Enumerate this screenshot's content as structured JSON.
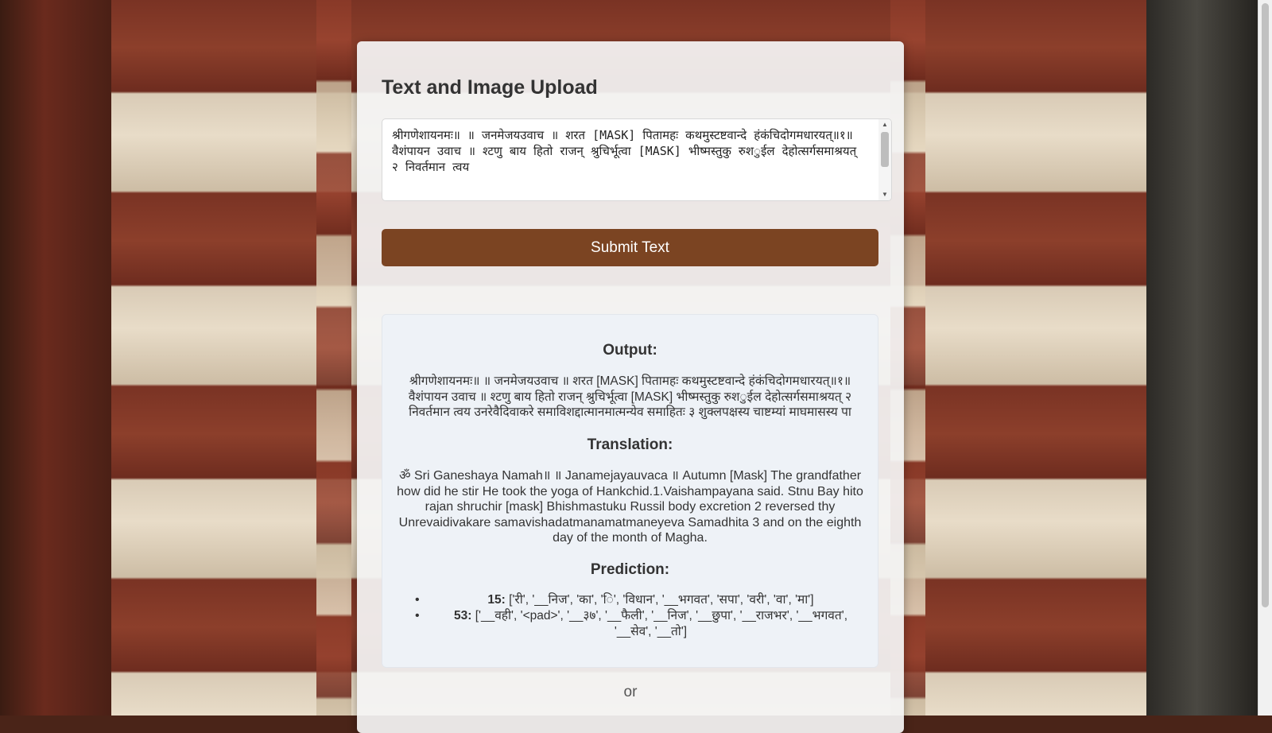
{
  "page": {
    "title": "Text and Image Upload",
    "input": {
      "value": "श्रीगणेशायनमः॥ ॥ जनमेजयउवाच ॥ शरत [MASK] पितामहः कथमुस्टष्टवान्दे हंकंचिदोगमधारयत्॥१॥वैशंपायन उवाच ॥ श्टणु बाय हितो राजन् श्रुचिर्भूत्वा [MASK] भीष्मस्तुकु रुश◌ुईल देहोत्सर्गसमाश्रयत् २ निवर्तमान त्वय"
    },
    "submit_label": "Submit Text",
    "or_label": "or"
  },
  "result": {
    "output_heading": "Output:",
    "output_text": "श्रीगणेशायनमः॥ ॥ जनमेजयउवाच ॥ शरत [MASK] पितामहः कथमुस्टष्टवान्दे हंकंचिदोगमधारयत्॥१॥ वैशंपायन उवाच ॥ श्टणु बाय हितो राजन् श्रुचिर्भूत्वा [MASK] भीष्मस्तुकु रुश◌ुईल देहोत्सर्गसमाश्रयत् २ निवर्तमान त्वय उनरेवैदिवाकरे समाविशद्दात्मानमात्मन्येव समाहितः ३ शुक्लपक्षस्य चाष्टम्यां माघमासस्य पा",
    "translation_heading": "Translation:",
    "translation_text": "ॐ Sri Ganeshaya Namah॥ ॥ Janamejayauvaca ॥ Autumn [Mask] The grandfather how did he stir He took the yoga of Hankchid.1.Vaishampayana said. Stnu Bay hito rajan shruchir [mask] Bhishmastuku Russil body excretion 2 reversed thy Unrevaidivakare samavishadatmanamatmaneyeva Samadhita 3 and on the eighth day of the month of Magha.",
    "prediction_heading": "Prediction:",
    "predictions": [
      {
        "key": "15:",
        "value": "['री', '__निज', 'का', '◌ि', 'विधान', '__भगवत', 'सपा', 'वरी', 'वा', 'मा']"
      },
      {
        "key": "53:",
        "value": "['__वही', '<pad>', '__३७', '__फैली', '__निज', '__छुपा', '__राजभर', '__भगवत', '__सेव', '__तो']"
      }
    ]
  },
  "colors": {
    "submit_button": "#7b4422",
    "result_panel": "#eef2f7",
    "card": "#f4f4f4"
  }
}
